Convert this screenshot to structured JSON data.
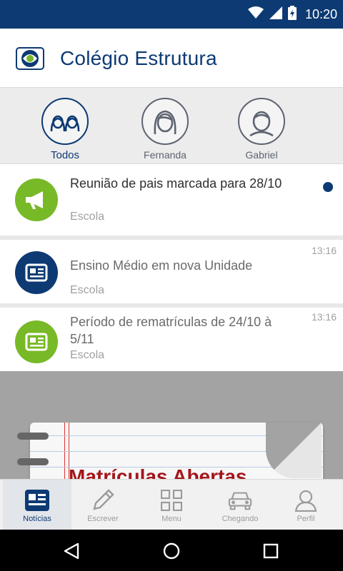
{
  "status_bar": {
    "time": "10:20",
    "icons": [
      "wifi-icon",
      "signal-icon",
      "battery-charging-icon"
    ]
  },
  "header": {
    "title": "Colégio Estrutura",
    "logo": "school-logo"
  },
  "profiles": [
    {
      "label": "Todos",
      "icon": "group-avatar-icon",
      "active": true
    },
    {
      "label": "Fernanda",
      "icon": "girl-avatar-icon",
      "active": false
    },
    {
      "label": "Gabriel",
      "icon": "boy-avatar-icon",
      "active": false
    }
  ],
  "feed": {
    "items": [
      {
        "title": "Reunião de pais marcada para 28/10",
        "source": "Escola",
        "time": "",
        "icon": "megaphone-icon",
        "icon_color": "#78b928",
        "unread": true
      },
      {
        "title": "Ensino Médio em nova Unidade",
        "source": "Escola",
        "time": "13:16",
        "icon": "newspaper-icon",
        "icon_color": "#0d3a73",
        "unread": false
      },
      {
        "title": "Período de rematrículas de 24/10 à 5/11",
        "source": "Escola",
        "time": "13:16",
        "icon": "newspaper-icon",
        "icon_color": "#78b928",
        "unread": false
      }
    ],
    "banner_text": "Matrículas Abertas"
  },
  "bottom_nav": [
    {
      "label": "Notícias",
      "icon": "news-icon",
      "active": true
    },
    {
      "label": "Escrever",
      "icon": "pencil-icon",
      "active": false
    },
    {
      "label": "Menu",
      "icon": "grid-icon",
      "active": false
    },
    {
      "label": "Chegando",
      "icon": "car-icon",
      "active": false
    },
    {
      "label": "Perfil",
      "icon": "person-icon",
      "active": false
    }
  ],
  "colors": {
    "primary": "#0d3a73",
    "accent_green": "#78b928",
    "unread_dot": "#0d3a73"
  },
  "system_nav": [
    "back-icon",
    "home-icon",
    "recents-icon"
  ]
}
